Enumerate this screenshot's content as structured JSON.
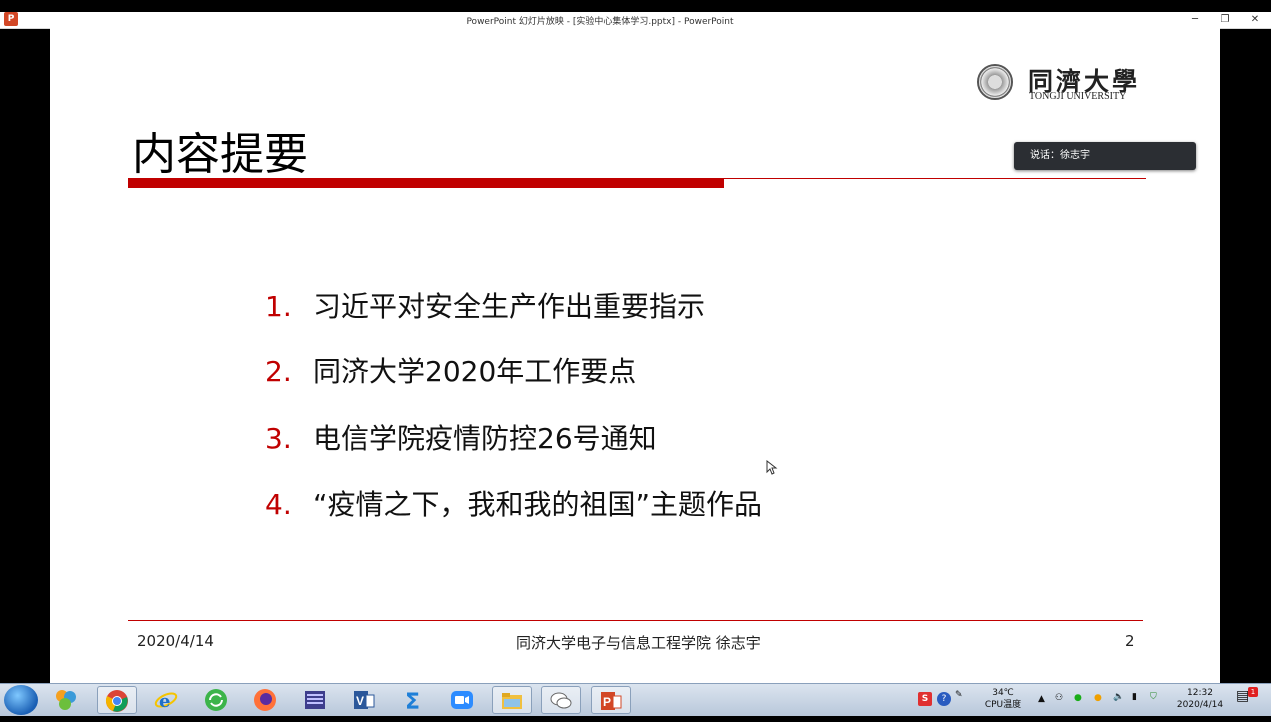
{
  "window": {
    "title": "PowerPoint 幻灯片放映 - [实验中心集体学习.pptx] - PowerPoint",
    "minimize_glyph": "─",
    "restore_glyph": "❐",
    "close_glyph": "✕",
    "app_icon_label": "P"
  },
  "slide": {
    "logo": {
      "name_cn": "同濟大學",
      "name_en": "TONGJI UNIVERSITY"
    },
    "title": "内容提要",
    "items": [
      {
        "num": "1.",
        "text": "习近平对安全生产作出重要指示"
      },
      {
        "num": "2.",
        "text": "同济大学2020年工作要点"
      },
      {
        "num": "3.",
        "text": "电信学院疫情防控26号通知"
      },
      {
        "num": "4.",
        "text": "“疫情之下，我和我的祖国”主题作品"
      }
    ],
    "footer": {
      "date": "2020/4/14",
      "center": "同济大学电子与信息工程学院 徐志宇",
      "page": "2"
    },
    "accent_color": "#c00000"
  },
  "chat_popup": {
    "text": "说话：徐志宇"
  },
  "taskbar": {
    "apps": [
      {
        "name": "start",
        "icon": "windows-start-icon"
      },
      {
        "name": "app-colored",
        "icon": "colorful-app-icon"
      },
      {
        "name": "chrome",
        "icon": "chrome-icon"
      },
      {
        "name": "ie",
        "icon": "ie-icon"
      },
      {
        "name": "app-green",
        "icon": "green-sync-icon"
      },
      {
        "name": "firefox",
        "icon": "firefox-icon"
      },
      {
        "name": "app-grid",
        "icon": "grid-app-icon"
      },
      {
        "name": "visio",
        "icon": "visio-icon"
      },
      {
        "name": "sigma",
        "icon": "sigma-icon"
      },
      {
        "name": "zoom",
        "icon": "zoom-icon"
      },
      {
        "name": "explorer",
        "icon": "folder-icon"
      },
      {
        "name": "wechat",
        "icon": "wechat-icon"
      },
      {
        "name": "powerpoint",
        "icon": "powerpoint-icon"
      }
    ],
    "tray": {
      "temp": "34℃",
      "temp_label": "CPU温度",
      "time": "12:32",
      "date": "2020/4/14",
      "notif_count": "1"
    }
  }
}
